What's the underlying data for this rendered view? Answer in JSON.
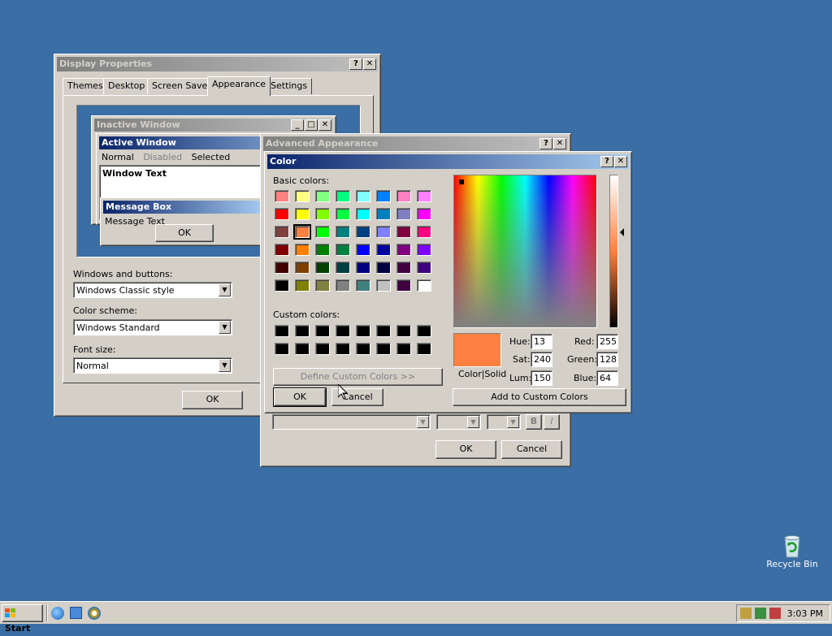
{
  "display_properties": {
    "title": "Display Properties",
    "tabs": [
      "Themes",
      "Desktop",
      "Screen Saver",
      "Appearance",
      "Settings"
    ],
    "preview": {
      "inactive_title": "Inactive Window",
      "active_title": "Active Window",
      "menu": [
        "Normal",
        "Disabled",
        "Selected"
      ],
      "window_text": "Window Text",
      "msgbox_title": "Message Box",
      "msgbox_text": "Message Text",
      "msgbox_ok": "OK"
    },
    "windows_buttons_label": "Windows and buttons:",
    "windows_buttons_value": "Windows Classic style",
    "color_scheme_label": "Color scheme:",
    "color_scheme_value": "Windows Standard",
    "font_size_label": "Font size:",
    "font_size_value": "Normal",
    "ok": "OK"
  },
  "advanced_appearance": {
    "title": "Advanced Appearance",
    "ok": "OK",
    "cancel": "Cancel",
    "bold": "B",
    "italic": "I"
  },
  "color_dialog": {
    "title": "Color",
    "basic_colors_label": "Basic colors:",
    "basic_colors": [
      [
        "#ff8080",
        "#ffff80",
        "#80ff80",
        "#00ff80",
        "#80ffff",
        "#0080ff",
        "#ff80c0",
        "#ff80ff"
      ],
      [
        "#ff0000",
        "#ffff00",
        "#80ff00",
        "#00ff40",
        "#00ffff",
        "#0080c0",
        "#8080c0",
        "#ff00ff"
      ],
      [
        "#804040",
        "#ff8040",
        "#00ff00",
        "#008080",
        "#004080",
        "#8080ff",
        "#800040",
        "#ff0080"
      ],
      [
        "#800000",
        "#ff8000",
        "#008000",
        "#008040",
        "#0000ff",
        "#0000a0",
        "#800080",
        "#8000ff"
      ],
      [
        "#400000",
        "#804000",
        "#004000",
        "#004040",
        "#000080",
        "#000040",
        "#400040",
        "#400080"
      ],
      [
        "#000000",
        "#808000",
        "#808040",
        "#808080",
        "#408080",
        "#c0c0c0",
        "#400040",
        "#ffffff"
      ]
    ],
    "selected_basic": "#ff8040",
    "custom_colors_label": "Custom colors:",
    "custom_colors": [
      "#000000",
      "#000000",
      "#000000",
      "#000000",
      "#000000",
      "#000000",
      "#000000",
      "#000000",
      "#000000",
      "#000000",
      "#000000",
      "#000000",
      "#000000",
      "#000000",
      "#000000",
      "#000000"
    ],
    "define_custom": "Define Custom Colors >>",
    "ok": "OK",
    "cancel": "Cancel",
    "color_solid_label": "Color|Solid",
    "current_color": "#ff8040",
    "hue_label": "Hue:",
    "hue": "13",
    "sat_label": "Sat:",
    "sat": "240",
    "lum_label": "Lum:",
    "lum": "150",
    "red_label": "Red:",
    "red": "255",
    "green_label": "Green:",
    "green": "128",
    "blue_label": "Blue:",
    "blue": "64",
    "add_custom": "Add to Custom Colors"
  },
  "desktop": {
    "recycle_bin": "Recycle Bin"
  },
  "taskbar": {
    "start": "Start",
    "clock": "3:03 PM"
  }
}
